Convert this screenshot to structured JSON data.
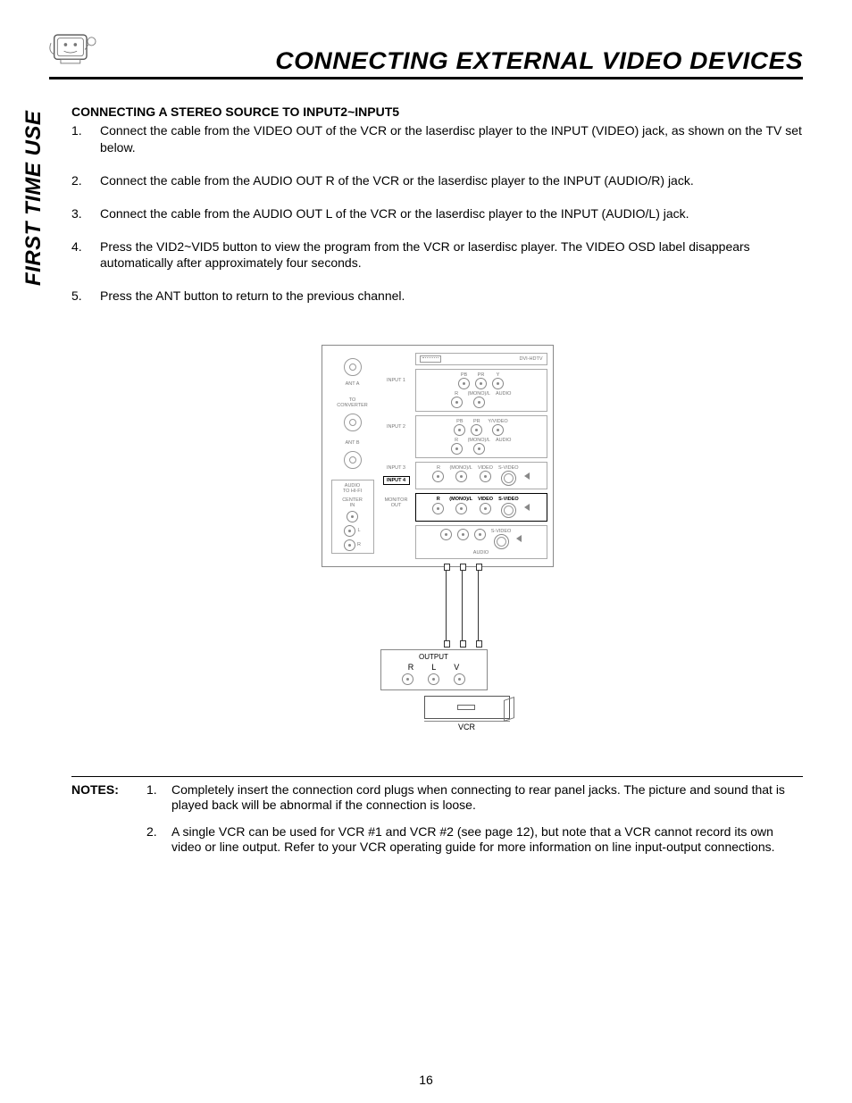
{
  "header": {
    "title": "CONNECTING EXTERNAL VIDEO DEVICES"
  },
  "side_label": "FIRST TIME USE",
  "section_heading": "CONNECTING A STEREO SOURCE TO INPUT2~INPUT5",
  "steps": [
    "Connect the cable from the VIDEO OUT of the VCR or the laserdisc player to the INPUT (VIDEO) jack, as shown on the TV set below.",
    "Connect the cable from the AUDIO OUT R of the VCR or the laserdisc player to the INPUT (AUDIO/R) jack.",
    "Connect the cable from the AUDIO OUT L of the VCR or the laserdisc player to the INPUT (AUDIO/L) jack.",
    "Press the VID2~VID5 button to view the program from the VCR or laserdisc player.  The VIDEO OSD label disappears automatically after approximately four seconds.",
    "Press the ANT button to return to the previous channel."
  ],
  "diagram": {
    "ant_a": "ANT A",
    "to_converter": "TO\nCONVERTER",
    "ant_b": "ANT B",
    "audio_to_hifi": "AUDIO\nTO HI-FI",
    "center_in": "CENTER\nIN",
    "input1": "INPUT 1",
    "input2": "INPUT 2",
    "input3": "INPUT 3",
    "input4": "INPUT 4",
    "monitor_out": "MONITOR\nOUT",
    "dvi": "DVI-HDTV",
    "pb": "PB",
    "pr": "PR",
    "y": "Y",
    "yvideo": "Y/VIDEO",
    "r": "R",
    "l": "L",
    "monol": "(MONO)/L",
    "audio": "AUDIO",
    "video": "VIDEO",
    "svideo": "S-VIDEO",
    "output": "OUTPUT",
    "out_r": "R",
    "out_l": "L",
    "out_v": "V",
    "vcr": "VCR"
  },
  "notes_label": "NOTES:",
  "notes": [
    "Completely insert the connection cord plugs when connecting to rear panel jacks.  The picture and sound that is played back will be abnormal if the connection is loose.",
    "A single VCR can be used for VCR #1 and VCR #2 (see page 12), but note that a VCR cannot record its own video or line output.  Refer to your VCR operating guide for more information on line input-output connections."
  ],
  "page_number": "16"
}
